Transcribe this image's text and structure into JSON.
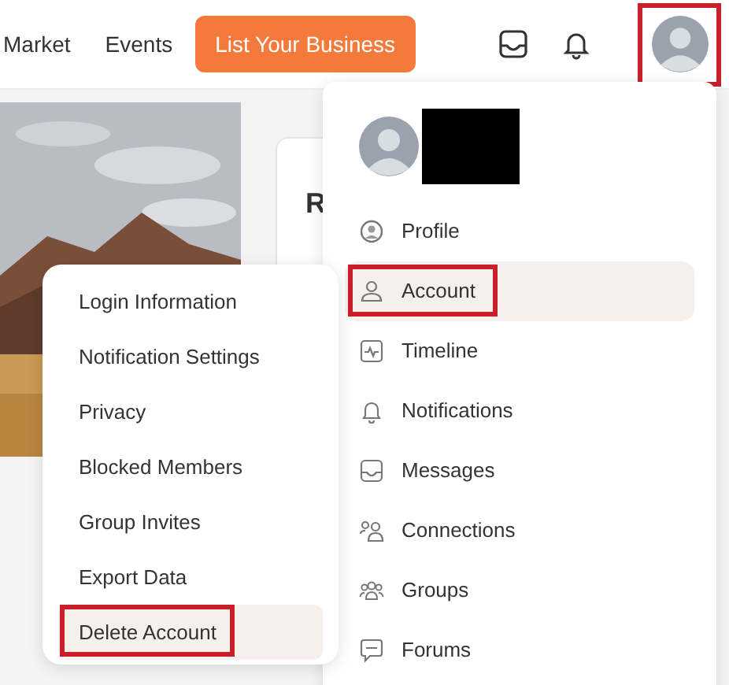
{
  "nav": {
    "links": [
      "Market",
      "Events"
    ],
    "cta": "List Your Business",
    "avatar_outlined": true
  },
  "card": {
    "heading": "R"
  },
  "user_menu": {
    "items": [
      {
        "label": "Profile",
        "kind": "profile",
        "selected": false,
        "outlined": false
      },
      {
        "label": "Account",
        "kind": "account",
        "selected": true,
        "outlined": true
      },
      {
        "label": "Timeline",
        "kind": "timeline",
        "selected": false,
        "outlined": false
      },
      {
        "label": "Notifications",
        "kind": "notifications",
        "selected": false,
        "outlined": false
      },
      {
        "label": "Messages",
        "kind": "messages",
        "selected": false,
        "outlined": false
      },
      {
        "label": "Connections",
        "kind": "connections",
        "selected": false,
        "outlined": false
      },
      {
        "label": "Groups",
        "kind": "groups",
        "selected": false,
        "outlined": false
      },
      {
        "label": "Forums",
        "kind": "forums",
        "selected": false,
        "outlined": false
      }
    ]
  },
  "account_menu": {
    "items": [
      {
        "label": "Login Information",
        "selected": false,
        "outlined": false
      },
      {
        "label": "Notification Settings",
        "selected": false,
        "outlined": false
      },
      {
        "label": "Privacy",
        "selected": false,
        "outlined": false
      },
      {
        "label": "Blocked Members",
        "selected": false,
        "outlined": false
      },
      {
        "label": "Group Invites",
        "selected": false,
        "outlined": false
      },
      {
        "label": "Export Data",
        "selected": false,
        "outlined": false
      },
      {
        "label": "Delete Account",
        "selected": true,
        "outlined": true
      }
    ]
  }
}
